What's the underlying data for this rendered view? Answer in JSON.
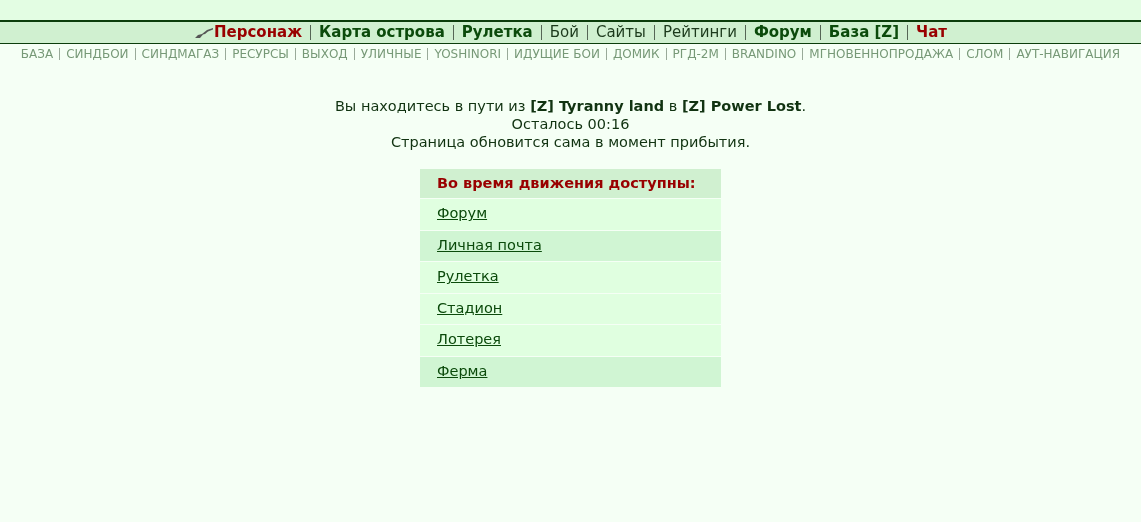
{
  "main_nav": [
    {
      "label": "Персонаж",
      "kind": "alert"
    },
    {
      "label": "Карта острова",
      "kind": "bold"
    },
    {
      "label": "Рулетка",
      "kind": "bold"
    },
    {
      "label": "Бой",
      "kind": "plain"
    },
    {
      "label": "Сайты",
      "kind": "plain"
    },
    {
      "label": "Рейтинги",
      "kind": "plain"
    },
    {
      "label": "Форум",
      "kind": "bold"
    },
    {
      "label": "База [Z]",
      "kind": "bold"
    },
    {
      "label": "Чат",
      "kind": "alert"
    }
  ],
  "sub_nav": [
    "БАЗА",
    "СИНДБОИ",
    "СИНДМАГАЗ",
    "РЕСУРСЫ",
    "ВЫХОД",
    "УЛИЧНЫЕ",
    "YOSHINORI",
    "ИДУЩИЕ БОИ",
    "ДОМИК",
    "РГД-2М",
    "BRANDINO",
    "МГНОВЕННОПРОДАЖА",
    "СЛОМ",
    "АУТ-НАВИГАЦИЯ"
  ],
  "travel": {
    "message": "Вы находитесь в пути из **[Z] Tyranny land** в **[Z] Power Lost**.",
    "remaining": "Осталось 00:16",
    "note": "Страница обновится сама в момент прибытия."
  },
  "available": {
    "title": "Во время движения доступны:",
    "items": [
      {
        "label": "Форум",
        "highlighted": false
      },
      {
        "label": "Личная почта",
        "highlighted": true
      },
      {
        "label": "Рулетка",
        "highlighted": false
      },
      {
        "label": "Стадион",
        "highlighted": false
      },
      {
        "label": "Лотерея",
        "highlighted": false
      },
      {
        "label": "Ферма",
        "highlighted": true
      }
    ]
  }
}
